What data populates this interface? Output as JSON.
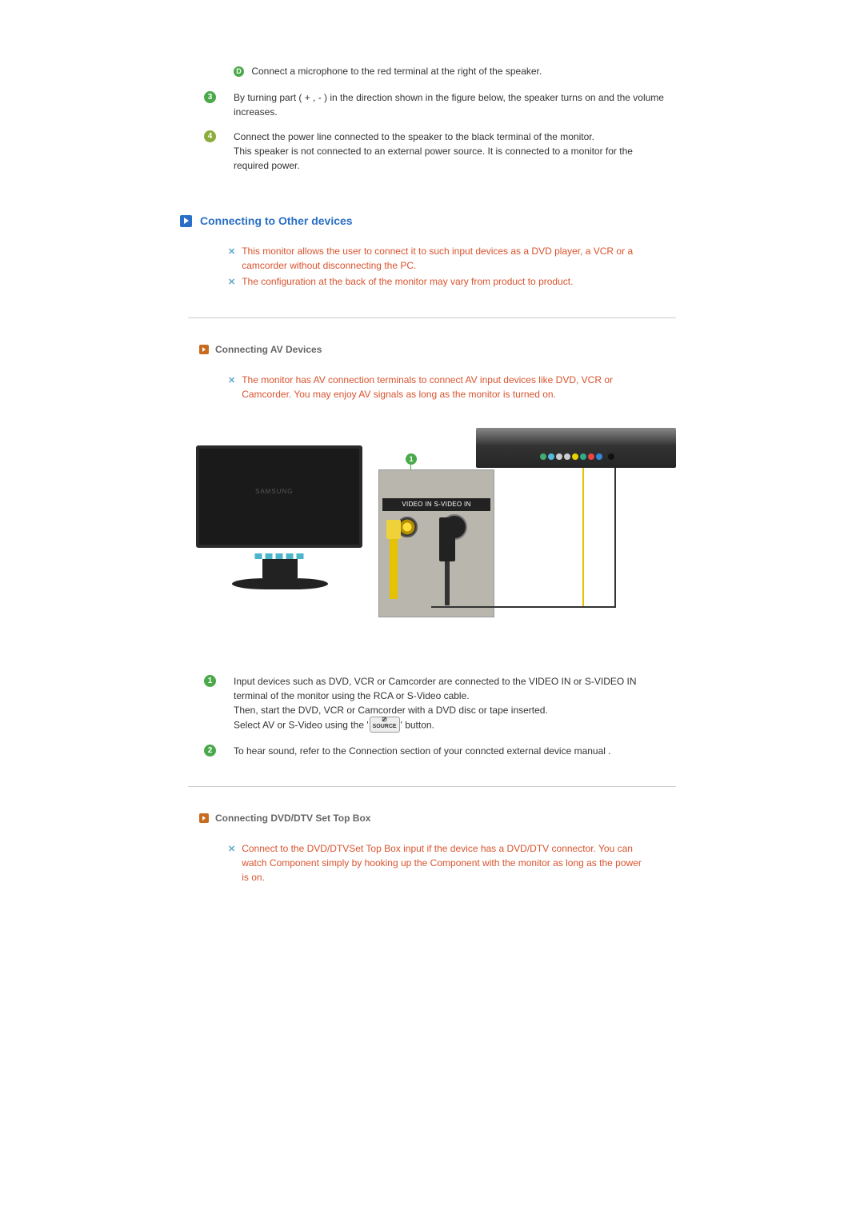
{
  "top": {
    "itemD": "Connect a microphone to the red terminal at the right of the speaker.",
    "item3": "By turning part ( + , - ) in the direction shown in the figure below, the speaker turns on and the volume increases.",
    "item4": "Connect the power line connected to the speaker to the black terminal of the monitor.\nThis speaker is not connected to an external power source. It is connected to a monitor for the required power."
  },
  "section1": {
    "title": "Connecting to Other devices",
    "note1": "This monitor allows the user to connect it to such input devices as a DVD player, a VCR or a camcorder without disconnecting the PC.",
    "note2": "The configuration at the back of the monitor may vary from product to product."
  },
  "av": {
    "title": "Connecting AV Devices",
    "note": "The monitor has AV connection terminals to connect AV input devices like DVD, VCR or Camcorder. You may enjoy AV signals as long as the monitor is turned on.",
    "panel_label": "VIDEO IN  S-VIDEO IN",
    "callout": "1",
    "monitor_logo": "SAMSUNG",
    "item1_a": "Input devices such as DVD, VCR or Camcorder are connected to the VIDEO IN or S-VIDEO IN terminal of the monitor using the RCA or S-Video cable.",
    "item1_b": "Then, start the DVD, VCR or Camcorder with a DVD disc or tape inserted.",
    "item1_c_pre": "Select AV or S-Video using the '",
    "item1_c_btn": "SOURCE",
    "item1_c_post": "' button.",
    "item2": "To hear sound, refer to the Connection section of your conncted external device manual ."
  },
  "dvd": {
    "title": "Connecting DVD/DTV Set Top Box",
    "note": "Connect to the DVD/DTVSet Top Box input if the device has a DVD/DTV connector. You can watch Component simply by hooking up the Component with the monitor as long as the power is on."
  }
}
